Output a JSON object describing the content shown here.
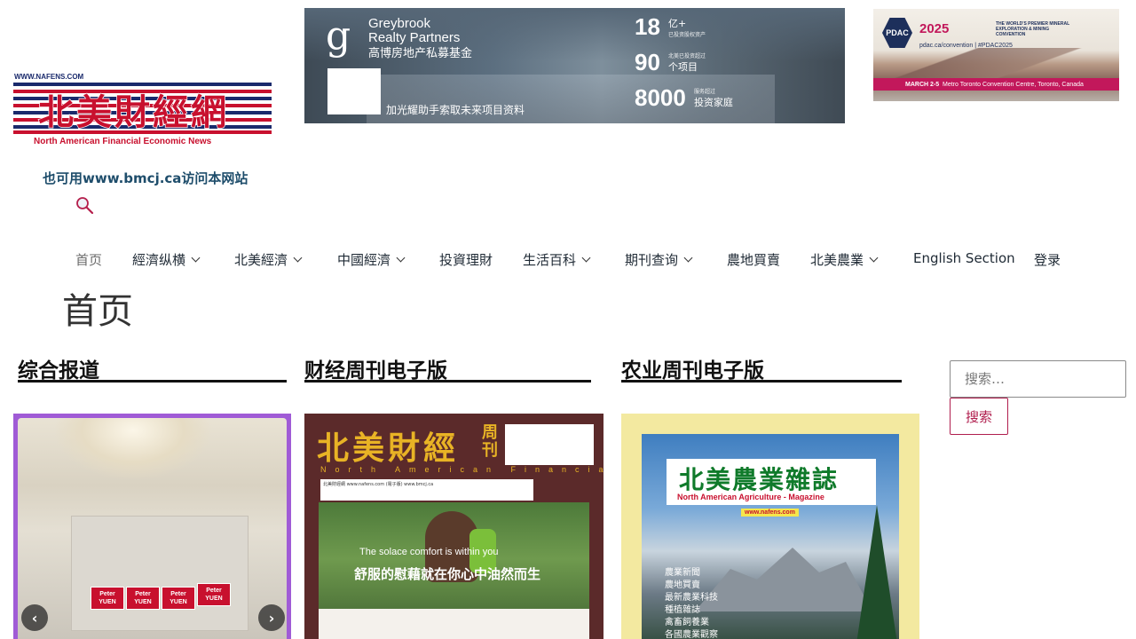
{
  "header": {
    "logo": {
      "url_text": "WWW.NAFENS.COM",
      "name_cn": "北美財經網",
      "name_en": "North American Financial Economic News"
    },
    "alt_site_text": "也可用www.bmcj.ca访问本网站",
    "search_icon": "search-icon"
  },
  "ads": {
    "greybrook": {
      "brand_line1": "Greybrook",
      "brand_line2": "Realty Partners",
      "brand_cn": "高博房地产私募基金",
      "cta": "加光耀助手索取未来项目资料",
      "stats": [
        {
          "num": "18",
          "unit": "亿+",
          "note": "已投资股权资产"
        },
        {
          "num": "90",
          "unit": "个项目",
          "note": "北美已投资超过"
        },
        {
          "num": "8000",
          "unit": "投资家庭",
          "note": "服务超过"
        }
      ]
    },
    "pdac": {
      "logo": "PDAC",
      "year": "2025",
      "tagline": "THE WORLD'S PREMIER MINERAL EXPLORATION & MINING CONVENTION",
      "site": "pdac.ca/convention | #PDAC2025",
      "dates": "MARCH 2-5",
      "venue": "Metro Toronto Convention Centre, Toronto, Canada"
    }
  },
  "nav": {
    "items": [
      {
        "label": "首页",
        "dropdown": false,
        "active": true
      },
      {
        "label": "經濟纵横",
        "dropdown": true
      },
      {
        "label": "北美經濟",
        "dropdown": true
      },
      {
        "label": "中國經濟",
        "dropdown": true
      },
      {
        "label": "投資理財",
        "dropdown": false
      },
      {
        "label": "生活百科",
        "dropdown": true
      },
      {
        "label": "期刊查询",
        "dropdown": true
      },
      {
        "label": "農地買賣",
        "dropdown": false
      },
      {
        "label": "北美農業",
        "dropdown": true
      },
      {
        "label": "English Section",
        "dropdown": false
      },
      {
        "label": "登录",
        "dropdown": false
      }
    ]
  },
  "page": {
    "title": "首页"
  },
  "columns": {
    "news": {
      "title": "综合报道",
      "signs": [
        "Peter YUEN",
        "Peter YUEN",
        "Peter YUEN",
        "Peter YUEN"
      ],
      "prev": "‹",
      "next": "›"
    },
    "finance_weekly": {
      "title": "财经周刊电子版",
      "masthead": "北美財經",
      "masthead_suffix": "周刊",
      "masthead_en": "North American Financial Weekly",
      "info": "北美財經網 www.nafens.com (電子版) www.bmcj.ca",
      "tagline_en": "The solace comfort is within you",
      "tagline_cn": "舒服的慰藉就在你心中油然而生"
    },
    "agri_weekly": {
      "title": "农业周刊电子版",
      "title_cn": "北美農業雜誌",
      "title_en": "North American Agriculture - Magazine",
      "url": "www.nafens.com",
      "menu": [
        "農業新聞",
        "農地買賣",
        "最新農業科技",
        "種植雜誌",
        "禽畜飼養業",
        "各國農業觀察"
      ]
    }
  },
  "sidebar": {
    "search_placeholder": "搜索…",
    "search_button": "搜索"
  },
  "colors": {
    "accent": "#b01e4e",
    "card_frame": "#a05bd6",
    "agri_frame": "#f3e9a0"
  }
}
